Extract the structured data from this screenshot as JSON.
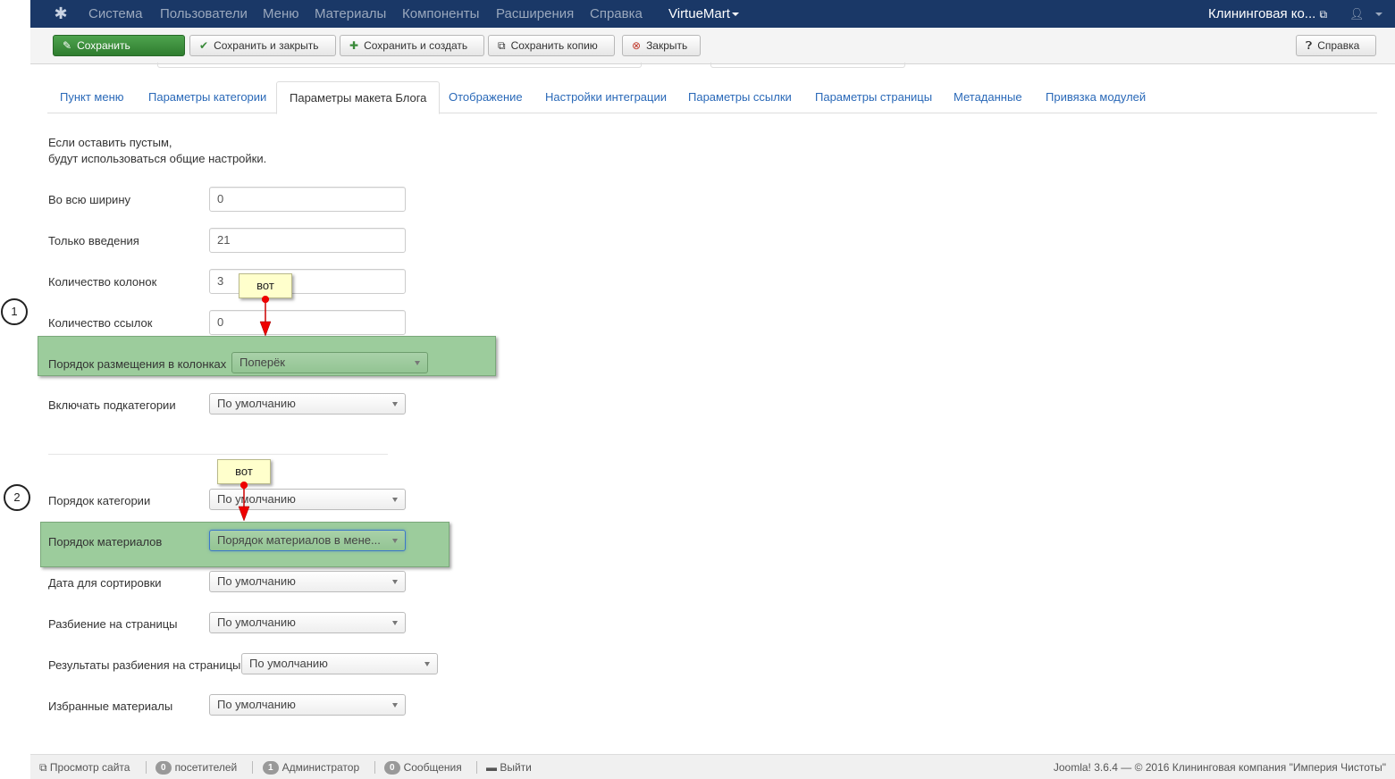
{
  "navbar": {
    "logo_icon": "joomla-logo-icon",
    "menu": [
      "Система",
      "Пользователи",
      "Меню",
      "Материалы",
      "Компоненты",
      "Расширения",
      "Справка"
    ],
    "virtuemart": "VirtueMart",
    "site_name": "Клининговая ко...",
    "external_icon": "external-link-icon",
    "user_icon": "user-icon"
  },
  "toolbar": {
    "save": "Сохранить",
    "save_close": "Сохранить и закрыть",
    "save_new": "Сохранить и создать",
    "save_copy": "Сохранить копию",
    "close": "Закрыть",
    "help": "Справка"
  },
  "tabs": [
    "Пункт меню",
    "Параметры категории",
    "Параметры макета Блога",
    "Отображение",
    "Настройки интеграции",
    "Параметры ссылки",
    "Параметры страницы",
    "Метаданные",
    "Привязка модулей"
  ],
  "active_tab": "Параметры макета Блога",
  "note": {
    "line1": "Если оставить пустым,",
    "line2": "будут использоваться общие настройки."
  },
  "form": {
    "full_width": {
      "label": "Во всю ширину",
      "value": "0"
    },
    "intro_only": {
      "label": "Только введения",
      "value": "21"
    },
    "columns": {
      "label": "Количество колонок",
      "value": "3"
    },
    "links": {
      "label": "Количество ссылок",
      "value": "0"
    },
    "column_order": {
      "label": "Порядок размещения в колонках",
      "value": "Поперёк"
    },
    "subcategories": {
      "label": "Включать подкатегории",
      "value": "По умолчанию"
    },
    "category_order": {
      "label": "Порядок категории",
      "value": "По умолчанию"
    },
    "article_order": {
      "label": "Порядок материалов",
      "value": "Порядок материалов в мене..."
    },
    "sort_date": {
      "label": "Дата для сортировки",
      "value": "По умолчанию"
    },
    "pagination": {
      "label": "Разбиение на страницы",
      "value": "По умолчанию"
    },
    "pagination_results": {
      "label": "Результаты разбиения на страницы",
      "value": "По умолчанию"
    },
    "featured": {
      "label": "Избранные материалы",
      "value": "По умолчанию"
    }
  },
  "annotations": {
    "marker1": "1",
    "marker2": "2",
    "callout1": "вот",
    "callout2": "вот",
    "highlight_color": "#9ccc9c",
    "arrow_color": "#cc0000"
  },
  "footer": {
    "view_site": "Просмотр сайта",
    "visitors_count": "0",
    "visitors": "посетителей",
    "admins_count": "1",
    "admins": "Администратор",
    "messages_count": "0",
    "messages": "Сообщения",
    "logout": "Выйти",
    "copyright": "Joomla! 3.6.4 — © 2016 Клининговая компания \"Империя Чистоты\""
  }
}
